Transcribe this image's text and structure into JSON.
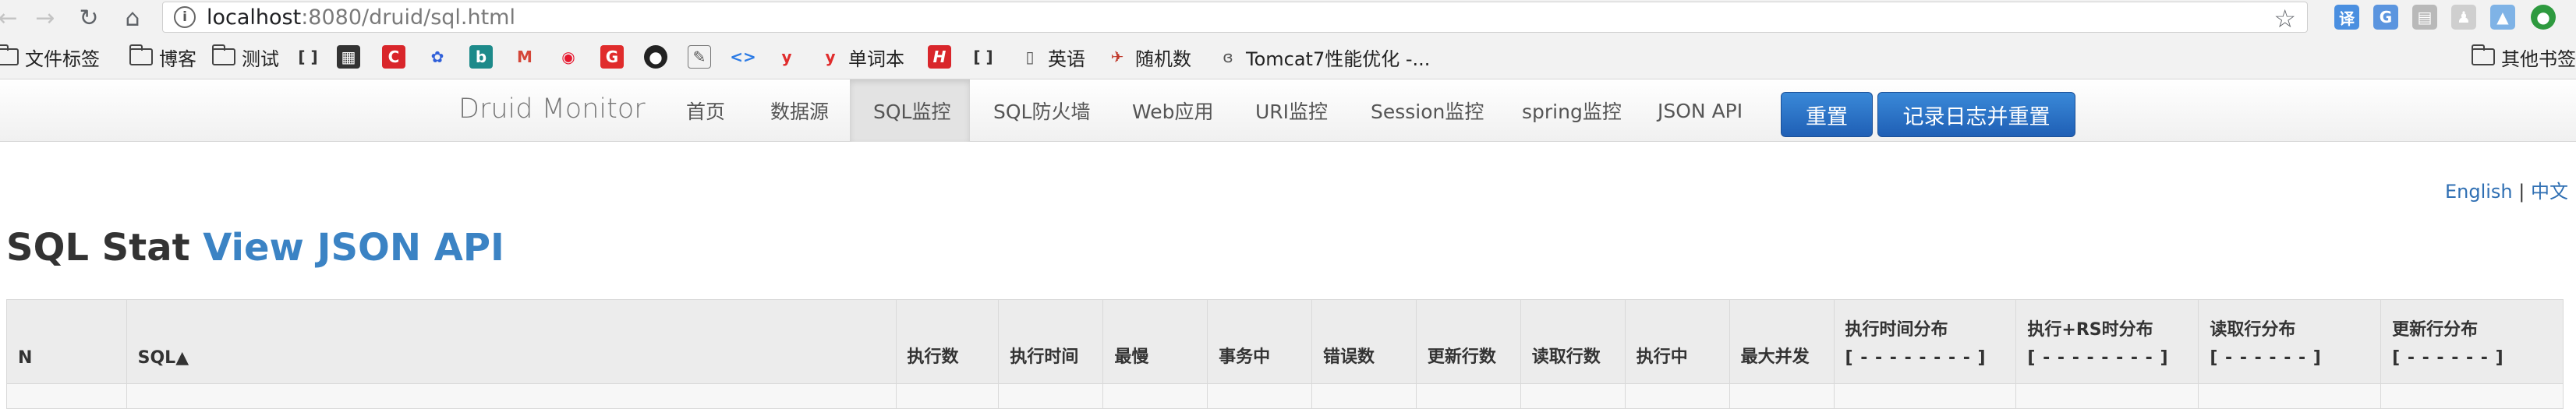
{
  "browser": {
    "url_host": "localhost",
    "url_rest": ":8080/druid/sql.html"
  },
  "bookmarks": [
    {
      "label": "文件标签",
      "icon": "folder-icon"
    },
    {
      "label": "博客",
      "icon": "folder-icon"
    },
    {
      "label": "测试",
      "icon": "folder-icon"
    },
    {
      "label": "单词本",
      "icon": "youdao-icon"
    },
    {
      "label": "英语",
      "icon": "page-icon"
    },
    {
      "label": "随机数",
      "icon": "random-icon"
    },
    {
      "label": "Tomcat7性能优化 -...",
      "icon": "tomcat-icon"
    },
    {
      "label": "其他书签",
      "icon": "folder-icon"
    }
  ],
  "druid": {
    "brand": "Druid Monitor",
    "nav": [
      "首页",
      "数据源",
      "SQL监控",
      "SQL防火墙",
      "Web应用",
      "URI监控",
      "Session监控",
      "spring监控",
      "JSON API"
    ],
    "reset_button": "重置",
    "log_reset_button": "记录日志并重置"
  },
  "lang": {
    "english": "English",
    "sep": " | ",
    "chinese": "中文"
  },
  "heading": {
    "title": "SQL Stat ",
    "link": "View JSON API"
  },
  "table": {
    "columns": [
      {
        "label": "N",
        "sub": ""
      },
      {
        "label": "SQL▲",
        "sub": ""
      },
      {
        "label": "执行数",
        "sub": ""
      },
      {
        "label": "执行时间",
        "sub": ""
      },
      {
        "label": "最慢",
        "sub": ""
      },
      {
        "label": "事务中",
        "sub": ""
      },
      {
        "label": "错误数",
        "sub": ""
      },
      {
        "label": "更新行数",
        "sub": ""
      },
      {
        "label": "读取行数",
        "sub": ""
      },
      {
        "label": "执行中",
        "sub": ""
      },
      {
        "label": "最大并发",
        "sub": ""
      },
      {
        "label": "执行时间分布",
        "sub": "[ - - - - - - - - ]"
      },
      {
        "label": "执行+RS时分布",
        "sub": "[ - - - - - - - - ]"
      },
      {
        "label": "读取行分布",
        "sub": "[ - - - - - - ]"
      },
      {
        "label": "更新行分布",
        "sub": "[ - - - - - - ]"
      }
    ]
  }
}
